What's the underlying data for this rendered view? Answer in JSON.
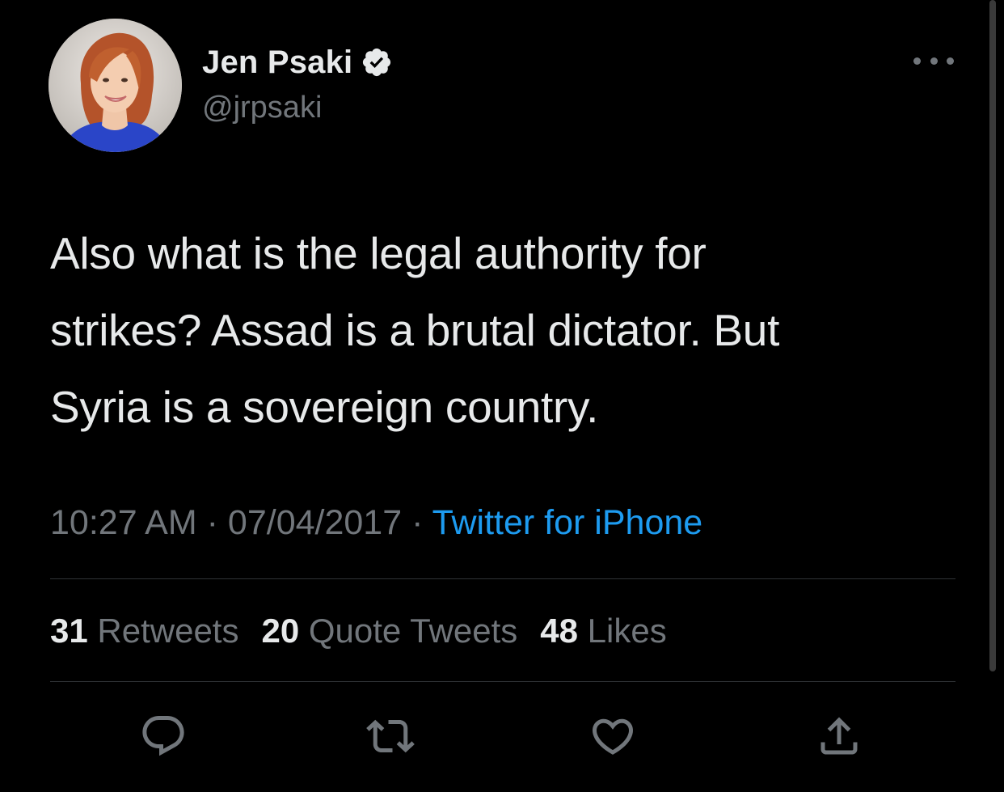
{
  "author": {
    "display_name": "Jen Psaki",
    "handle": "@jrpsaki",
    "verified": true
  },
  "tweet": {
    "text_lines": [
      "Also what is the legal authority for",
      "strikes? Assad is a brutal dictator. But",
      "Syria is a sovereign country."
    ],
    "time": "10:27 AM",
    "separator": "·",
    "date": "07/04/2017",
    "source": "Twitter for iPhone"
  },
  "stats": {
    "retweets_count": "31",
    "retweets_label": "Retweets",
    "quotes_count": "20",
    "quotes_label": "Quote Tweets",
    "likes_count": "48",
    "likes_label": "Likes"
  },
  "icons": {
    "verified": "verified-badge-icon",
    "more": "more-options-icon",
    "reply": "reply-icon",
    "retweet": "retweet-icon",
    "like": "heart-icon",
    "share": "share-icon"
  },
  "colors": {
    "background": "#000000",
    "text_primary": "#e7e9ea",
    "text_secondary": "#71767b",
    "link": "#1d9bf0",
    "divider": "#2f3336"
  }
}
